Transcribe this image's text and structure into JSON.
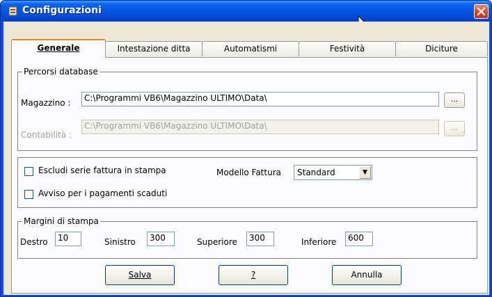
{
  "window": {
    "title": "Configurazioni"
  },
  "tabs": [
    {
      "label": "Generale",
      "active": true
    },
    {
      "label": "Intestazione ditta",
      "active": false
    },
    {
      "label": "Automatismi",
      "active": false
    },
    {
      "label": "Festività",
      "active": false
    },
    {
      "label": "Diciture",
      "active": false
    }
  ],
  "database": {
    "group_label": "Percorsi database",
    "magazzino_label": "Magazzino :",
    "magazzino_value": "C:\\Programmi VB6\\Magazzino ULTIMO\\Data\\",
    "contabilita_label": "Contabilità :",
    "contabilita_value": "C:\\Programmi VB6\\Magazzino ULTIMO\\Data\\",
    "browse_label": "..."
  },
  "options": {
    "escludi_label": "Escludi serie fattura in stampa",
    "escludi_checked": false,
    "avviso_label": "Avviso per i pagamenti scaduti",
    "avviso_checked": false,
    "modello_label": "Modello Fattura",
    "modello_value": "Standard"
  },
  "margini": {
    "group_label": "Margini di stampa",
    "destro_label": "Destro",
    "destro_value": "10",
    "sinistro_label": "Sinistro",
    "sinistro_value": "300",
    "superiore_label": "Superiore",
    "superiore_value": "300",
    "inferiore_label": "Inferiore",
    "inferiore_value": "600"
  },
  "buttons": {
    "salva": "Salva",
    "help": "?",
    "annulla": "Annulla"
  },
  "colors": {
    "titlebar": "#0054e3",
    "dialog_bg": "#ece9d8",
    "active_tab_accent": "#e68b2c"
  }
}
